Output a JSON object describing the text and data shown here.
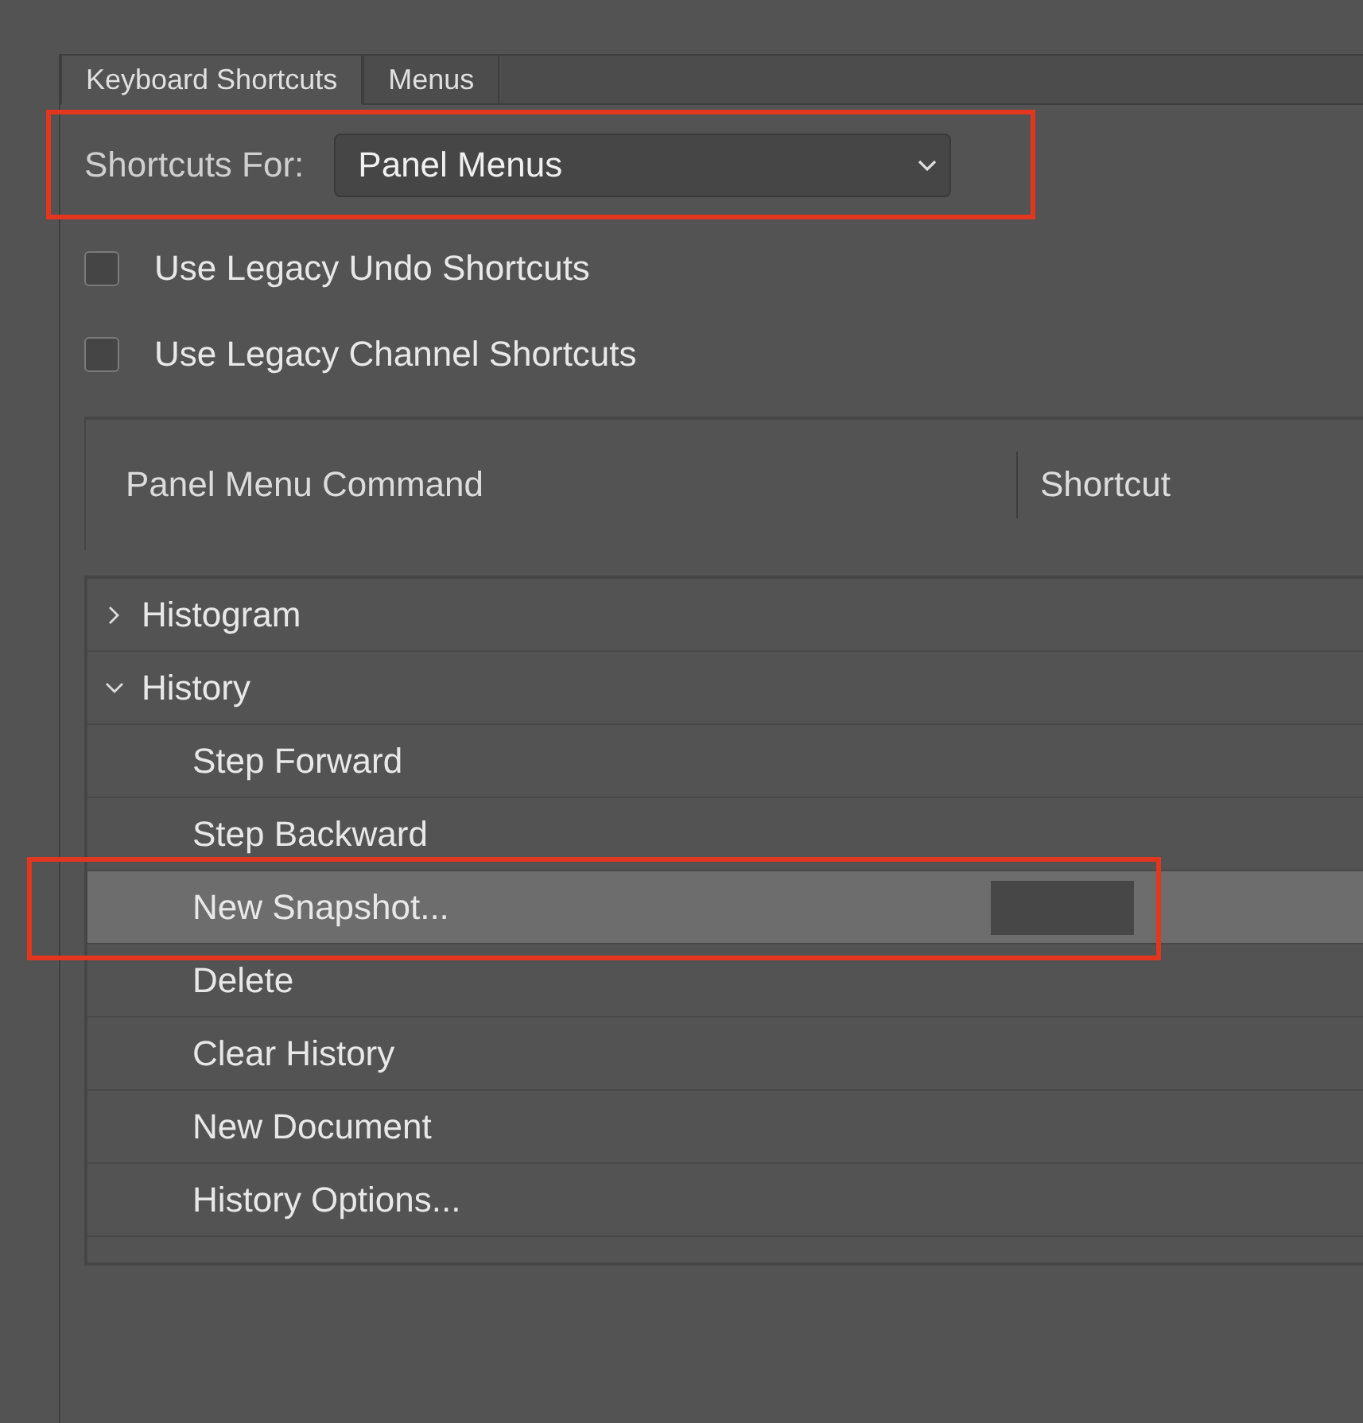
{
  "tabs": [
    {
      "label": "Keyboard Shortcuts",
      "selected": true
    },
    {
      "label": "Menus",
      "selected": false
    }
  ],
  "shortcuts_for": {
    "label": "Shortcuts For:",
    "value": "Panel Menus",
    "highlighted": true
  },
  "options": [
    {
      "label": "Use Legacy Undo Shortcuts",
      "checked": false
    },
    {
      "label": "Use Legacy Channel Shortcuts",
      "checked": false
    }
  ],
  "table": {
    "columns": [
      "Panel Menu Command",
      "Shortcut"
    ],
    "rows": [
      {
        "label": "Histogram",
        "expanded": false,
        "selected": false,
        "children": []
      },
      {
        "label": "History",
        "expanded": true,
        "selected": false,
        "children": [
          {
            "label": "Step Forward",
            "selected": false,
            "highlighted": false
          },
          {
            "label": "Step Backward",
            "selected": false,
            "highlighted": false
          },
          {
            "label": "New Snapshot...",
            "selected": true,
            "highlighted": true
          },
          {
            "label": "Delete",
            "selected": false,
            "highlighted": false
          },
          {
            "label": "Clear History",
            "selected": false,
            "highlighted": false
          },
          {
            "label": "New Document",
            "selected": false,
            "highlighted": false
          },
          {
            "label": "History Options...",
            "selected": false,
            "highlighted": false
          }
        ]
      }
    ]
  }
}
